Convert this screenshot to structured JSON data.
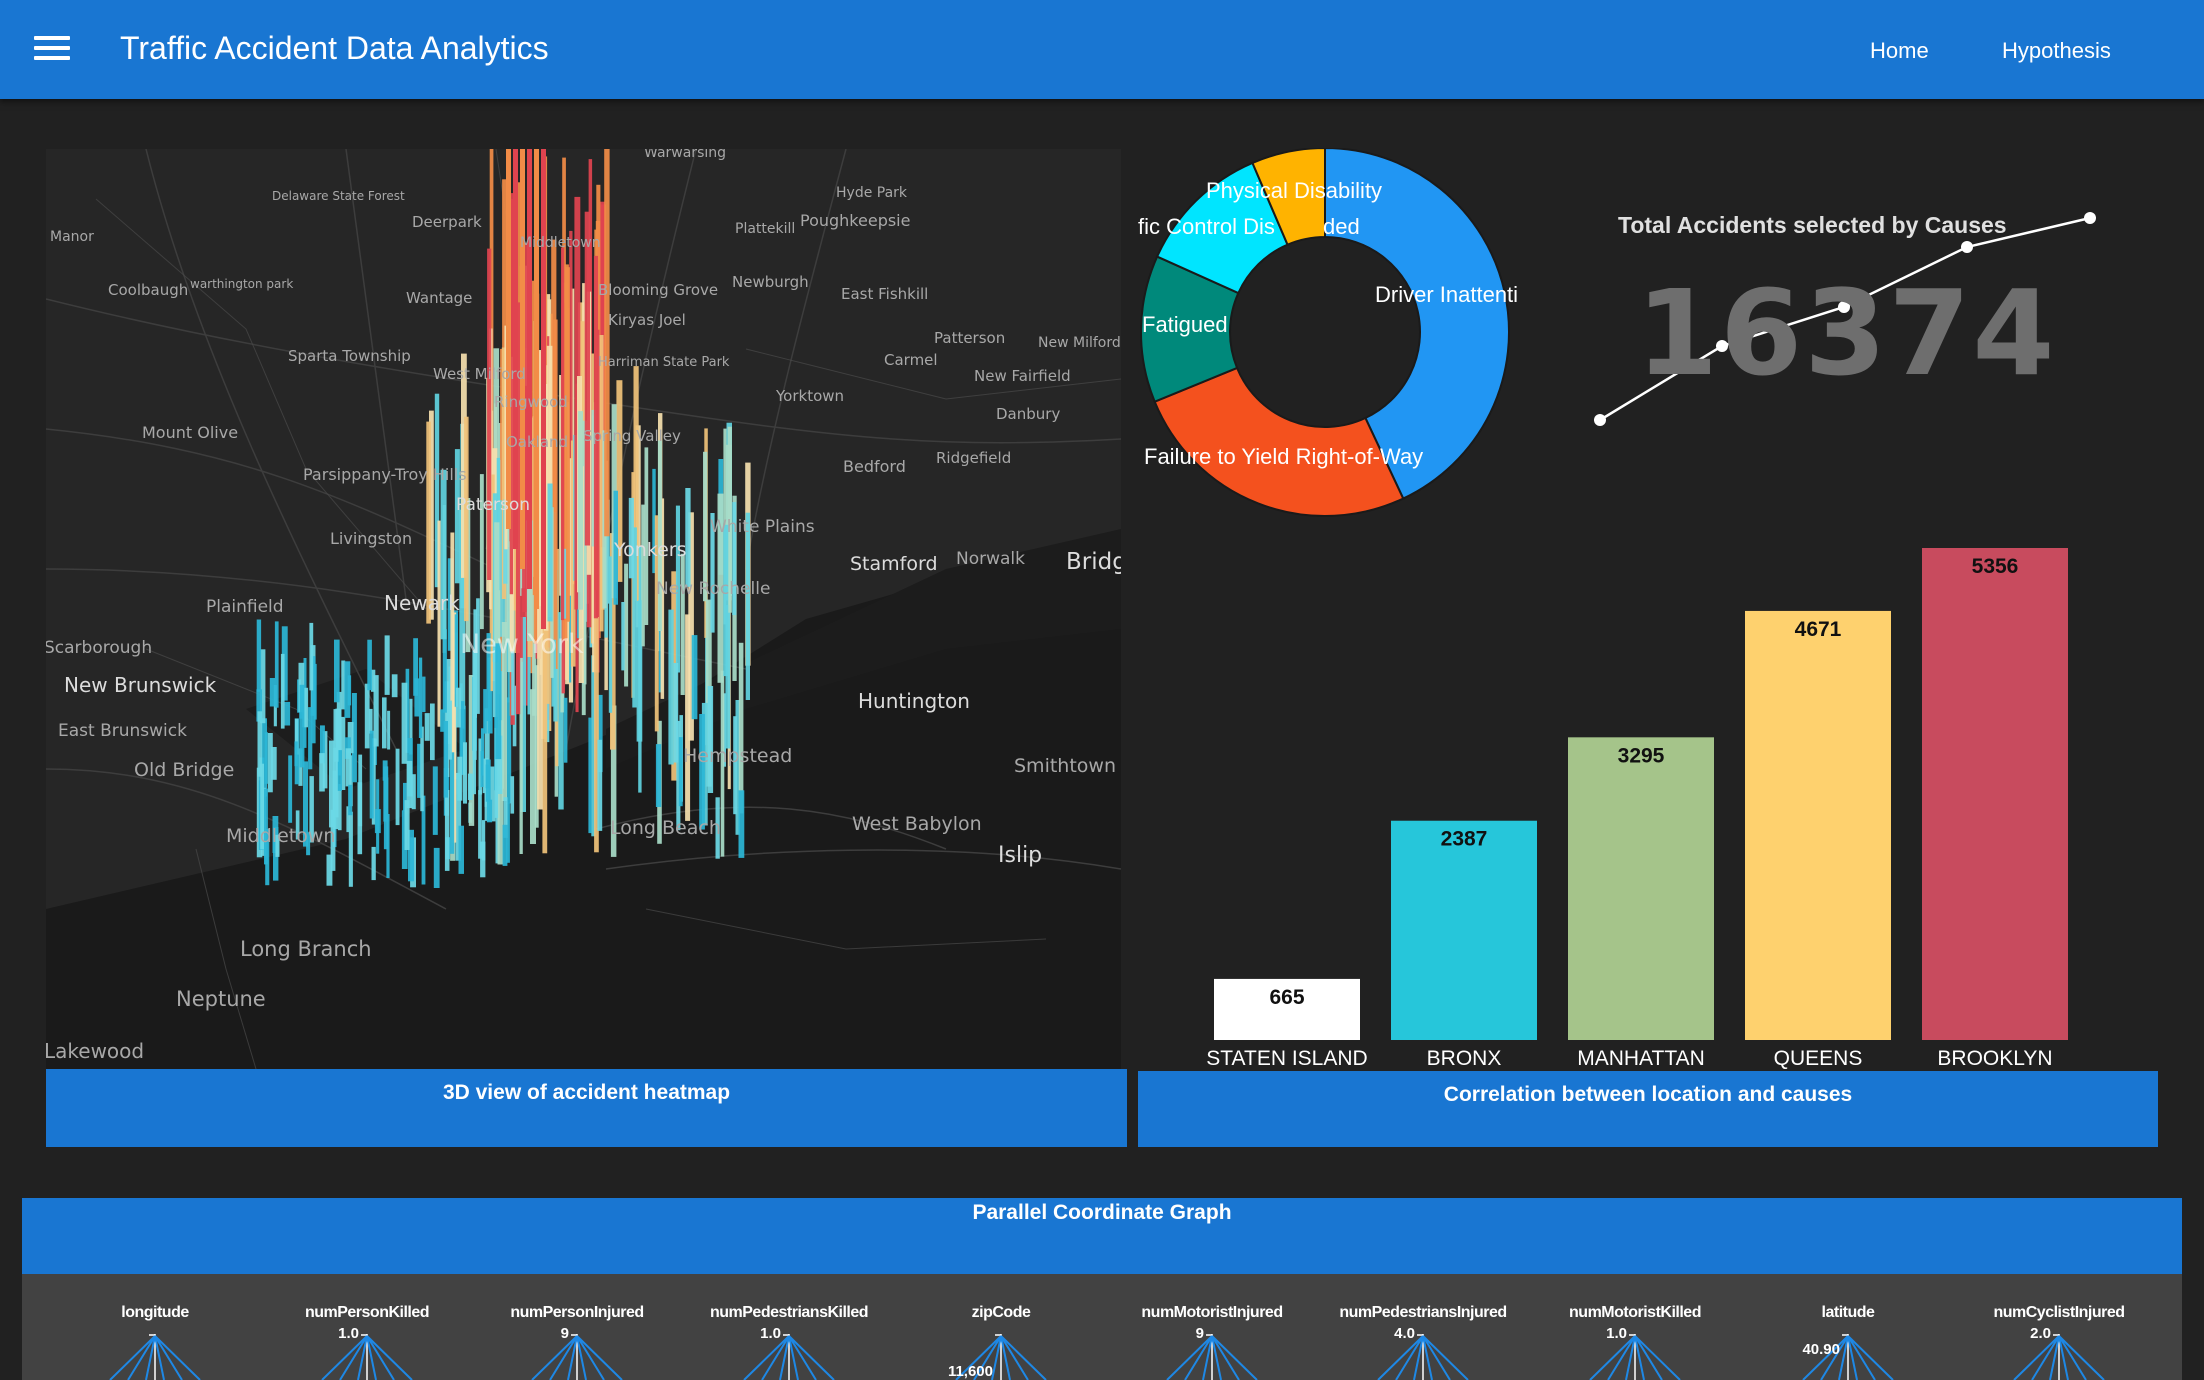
{
  "header": {
    "title": "Traffic Accident Data Analytics",
    "nav": [
      {
        "label": "Home"
      },
      {
        "label": "Hypothesis"
      }
    ],
    "menu_icon": "hamburger-menu-icon",
    "color": "#1976d2"
  },
  "map": {
    "caption": "3D view of accident heatmap",
    "places": [
      "Warwarsing",
      "Delaware State Forest",
      "Hyde Park",
      "Poughkeepsie",
      "Plattekill",
      "Manor",
      "Deerpark",
      "Middletown",
      "Coolbaugh",
      "warthington park",
      "Wantage",
      "Blooming Grove",
      "Newburgh",
      "East Fishkill",
      "Kiryas Joel",
      "Sparta Township",
      "West Milford",
      "Harriman State Park",
      "Patterson",
      "New Milford",
      "Carmel",
      "New Fairfield",
      "Yorktown",
      "Danbury",
      "Mount Olive",
      "Ringwood",
      "Spring Valley",
      "Oakland",
      "Ridgefield",
      "Bedford",
      "Parsippany-Troy Hills",
      "Paterson",
      "Livingston",
      "Yonkers",
      "White Plains",
      "Stamford",
      "Norwalk",
      "Bridgeport",
      "Plainfield",
      "Newark",
      "New Rochelle",
      "New York",
      "Scarborough",
      "New Brunswick",
      "Huntington",
      "East Brunswick",
      "Old Bridge",
      "Hempstead",
      "Smithtown",
      "Long Beach",
      "West Babylon",
      "Middletown",
      "Islip",
      "Long Branch",
      "Neptune",
      "Lakewood"
    ]
  },
  "donut": {
    "labels": [
      "Driver Inattention/Distraction",
      "Failure to Yield Right-of-Way",
      "Fatigued",
      "Traffic Control Disregarded",
      "Physical Disability"
    ],
    "visible_labels": {
      "physical": "Physical Disability",
      "traffic_left": "fic Control Dis",
      "traffic_right": "ded",
      "driver": "Driver Inattentic",
      "fatigued": "Fatigued",
      "failure": "Failure to Yield Right-of-Way"
    },
    "values": [
      40,
      24,
      12,
      11,
      6
    ],
    "colors": [
      "#2196f3",
      "#f4511e",
      "#00897b",
      "#00e5ff",
      "#ffb300"
    ]
  },
  "total": {
    "title": "Total Accidents selected by Causes",
    "value": "16374"
  },
  "chart_data": {
    "type": "bar",
    "categories": [
      "STATEN ISLAND",
      "BRONX",
      "MANHATTAN",
      "QUEENS",
      "BROOKLYN"
    ],
    "values": [
      665,
      2387,
      3295,
      4671,
      5356
    ],
    "colors": [
      "#ffffff",
      "#26c6da",
      "#a5c48a",
      "#fed16e",
      "#c84b5e"
    ],
    "ylim": [
      0,
      5356
    ]
  },
  "bar_caption": "Correlation between location and causes",
  "parallel": {
    "title": "Parallel Coordinate Graph",
    "axes": [
      {
        "name": "longitude",
        "tick": ""
      },
      {
        "name": "numPersonKilled",
        "tick": "1.0"
      },
      {
        "name": "numPersonInjured",
        "tick": "9"
      },
      {
        "name": "numPedestriansKilled",
        "tick": "1.0"
      },
      {
        "name": "zipCode",
        "tick": "11,600"
      },
      {
        "name": "numMotoristInjured",
        "tick": "9"
      },
      {
        "name": "numPedestriansInjured",
        "tick": "4.0"
      },
      {
        "name": "numMotoristKilled",
        "tick": "1.0"
      },
      {
        "name": "latitude",
        "tick": "40.90"
      },
      {
        "name": "numCyclistInjured",
        "tick": "2.0"
      }
    ]
  }
}
